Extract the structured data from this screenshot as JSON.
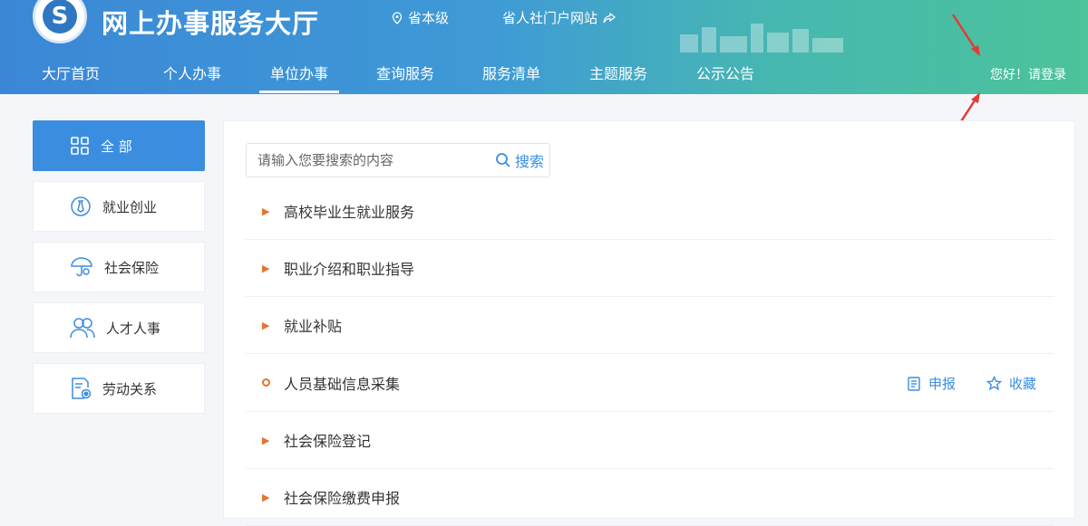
{
  "header": {
    "title": "网上办事服务大厅",
    "region": "省本级",
    "portal_link": "省人社门户网站",
    "login_text": "您好！请登录",
    "nav": [
      "大厅首页",
      "个人办事",
      "单位办事",
      "查询服务",
      "服务清单",
      "主题服务",
      "公示公告"
    ],
    "active_nav": "单位办事"
  },
  "sidebar": {
    "items": [
      {
        "label": "全 部",
        "icon": "grid-icon"
      },
      {
        "label": "就业创业",
        "icon": "employment-icon"
      },
      {
        "label": "社会保险",
        "icon": "umbrella-icon"
      },
      {
        "label": "人才人事",
        "icon": "people-icon"
      },
      {
        "label": "劳动关系",
        "icon": "document-seal-icon"
      }
    ]
  },
  "main": {
    "search": {
      "placeholder": "请输入您要搜索的内容",
      "button_label": "搜索"
    },
    "items": [
      {
        "label": "高校毕业生就业服务",
        "marker": "triangle"
      },
      {
        "label": "职业介绍和职业指导",
        "marker": "triangle"
      },
      {
        "label": "就业补贴",
        "marker": "triangle"
      },
      {
        "label": "人员基础信息采集",
        "marker": "ring",
        "apply_label": "申报",
        "favorite_label": "收藏"
      },
      {
        "label": "社会保险登记",
        "marker": "triangle"
      },
      {
        "label": "社会保险缴费申报",
        "marker": "triangle"
      }
    ]
  },
  "colors": {
    "accent": "#3b8de0",
    "marker": "#e8732a",
    "header_start": "#3b87d6",
    "header_end": "#4cc39a",
    "annotation_arrow": "#e53935"
  }
}
